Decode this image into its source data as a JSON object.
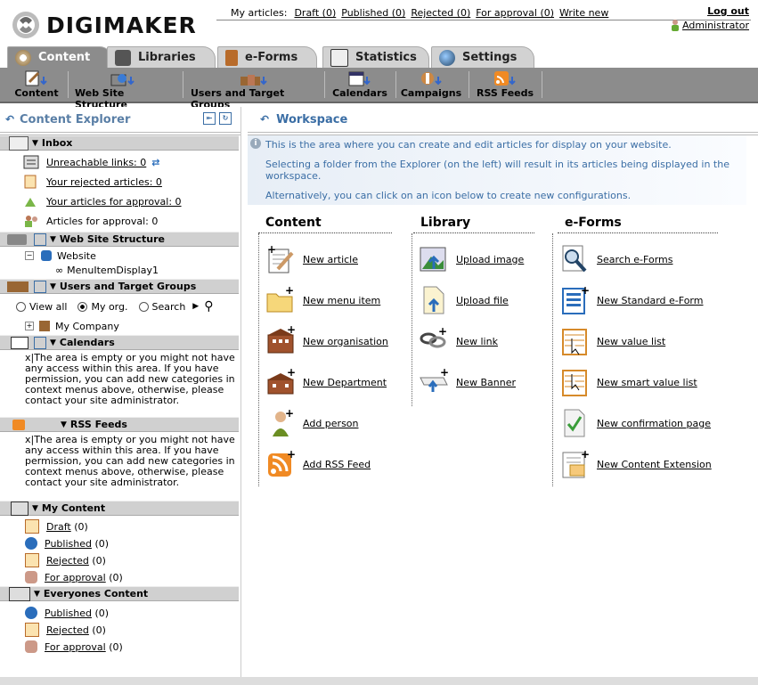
{
  "app": {
    "logo_text": "DIGIMAKER"
  },
  "topbar": {
    "my_articles_label": "My articles:",
    "draft": "Draft (0)",
    "published": "Published (0)",
    "rejected": "Rejected (0)",
    "for_approval": "For approval (0)",
    "write_new": "Write new",
    "logout": "Log out",
    "user": "Administrator"
  },
  "tabs": [
    {
      "label": "Content",
      "active": true
    },
    {
      "label": "Libraries"
    },
    {
      "label": "e-Forms"
    },
    {
      "label": "Statistics"
    },
    {
      "label": "Settings"
    }
  ],
  "subtoolbar": [
    {
      "label": "Content"
    },
    {
      "label": "Web Site Structure"
    },
    {
      "label": "Users and Target Groups"
    },
    {
      "label": "Calendars"
    },
    {
      "label": "Campaigns"
    },
    {
      "label": "RSS Feeds"
    }
  ],
  "explorer": {
    "title": "Content Explorer",
    "inbox": {
      "title": "Inbox",
      "items": [
        "Unreachable links: 0",
        "Your rejected articles: 0",
        "Your articles for approval: 0",
        "Articles for approval: 0"
      ]
    },
    "website_structure": {
      "title": "Web Site Structure",
      "root": "Website",
      "child": "MenuItemDisplay1"
    },
    "users": {
      "title": "Users and Target Groups",
      "view_all": "View all",
      "my_org": "My org.",
      "search": "Search",
      "company": "My Company"
    },
    "calendars": {
      "title": "Calendars",
      "empty": "x|The area is empty or you might not have any access within this area. If you have permission, you can add new categories in context menus above, otherwise, please contact your site administrator."
    },
    "rss": {
      "title": "RSS Feeds",
      "empty": "x|The area is empty or you might not have any access within this area. If you have permission, you can add new categories in context menus above, otherwise, please contact your site administrator."
    },
    "my_content": {
      "title": "My Content",
      "items": [
        {
          "label": "Draft",
          "count": "(0)"
        },
        {
          "label": "Published",
          "count": "(0)"
        },
        {
          "label": "Rejected",
          "count": "(0)"
        },
        {
          "label": "For approval",
          "count": "(0)"
        }
      ]
    },
    "everyones_content": {
      "title": "Everyones Content",
      "items": [
        {
          "label": "Published",
          "count": "(0)"
        },
        {
          "label": "Rejected",
          "count": "(0)"
        },
        {
          "label": "For approval",
          "count": "(0)"
        }
      ]
    }
  },
  "workspace": {
    "title": "Workspace",
    "info1": "This is the area where you can create and edit articles for display on your website.",
    "info2": "Selecting a folder from the Explorer (on the left) will result in its articles being displayed in the workspace.",
    "info3": "Alternatively, you can click on an icon below to create new configurations.",
    "columns": [
      {
        "title": "Content",
        "items": [
          "New article",
          "New menu item",
          "New organisation",
          "New Department",
          "Add person",
          "Add RSS Feed"
        ]
      },
      {
        "title": "Library",
        "items": [
          "Upload image",
          "Upload file",
          "New link",
          "New Banner"
        ]
      },
      {
        "title": "e-Forms",
        "items": [
          "Search e-Forms",
          "New Standard e-Form",
          "New value list",
          "New smart value list",
          "New confirmation page",
          "New Content Extension"
        ]
      }
    ]
  }
}
